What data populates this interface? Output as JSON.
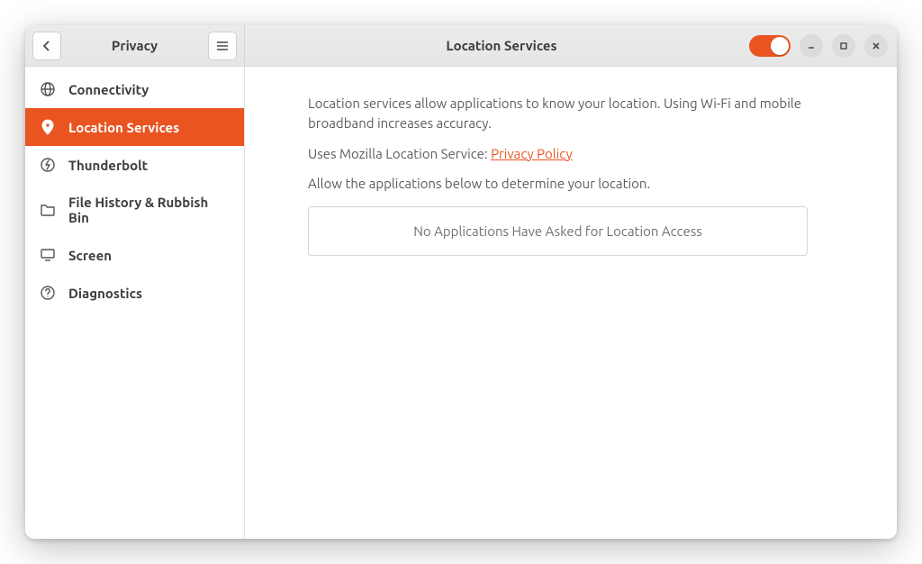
{
  "header": {
    "sidebar_title": "Privacy",
    "content_title": "Location Services",
    "toggle_on": true
  },
  "sidebar": {
    "items": [
      {
        "icon": "globe-icon",
        "label": "Connectivity",
        "active": false
      },
      {
        "icon": "location-icon",
        "label": "Location Services",
        "active": true
      },
      {
        "icon": "thunderbolt-icon",
        "label": "Thunderbolt",
        "active": false
      },
      {
        "icon": "folder-icon",
        "label": "File History & Rubbish Bin",
        "active": false
      },
      {
        "icon": "monitor-icon",
        "label": "Screen",
        "active": false
      },
      {
        "icon": "help-icon",
        "label": "Diagnostics",
        "active": false
      }
    ]
  },
  "content": {
    "intro": "Location services allow applications to know your location. Using Wi-Fi and mobile broadband increases accuracy.",
    "provider_prefix": "Uses Mozilla Location Service: ",
    "provider_link_label": "Privacy Policy",
    "allow_text": "Allow the applications below to determine your location.",
    "no_apps": "No Applications Have Asked for Location Access"
  },
  "colors": {
    "accent": "#e95420"
  }
}
